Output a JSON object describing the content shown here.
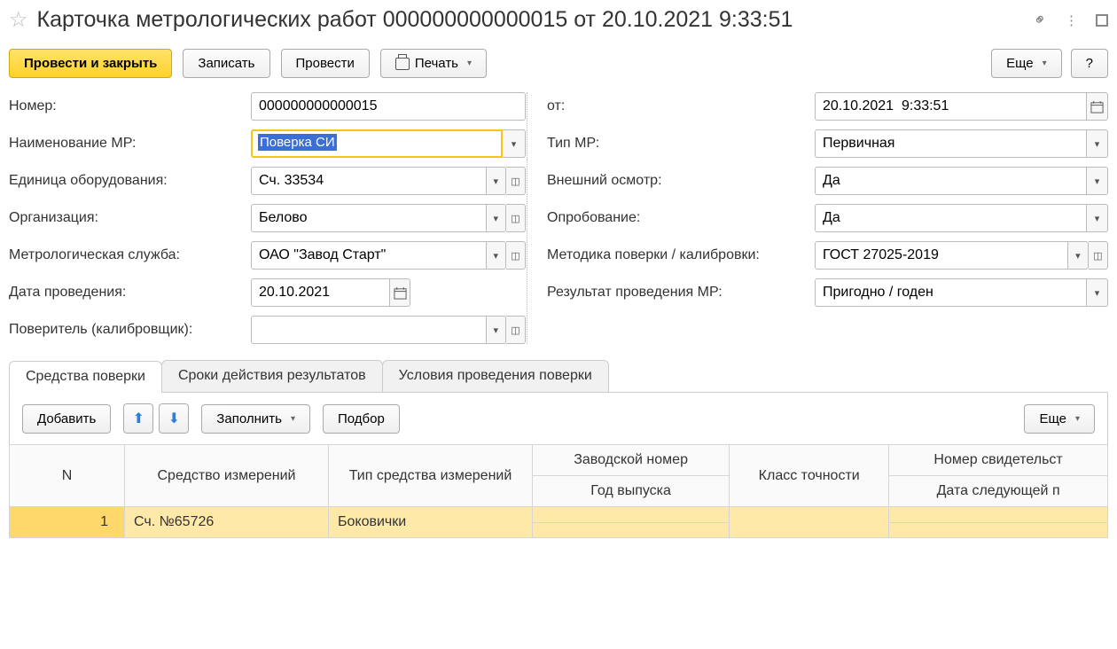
{
  "header": {
    "title": "Карточка метрологических работ 000000000000015 от 20.10.2021 9:33:51"
  },
  "toolbar": {
    "post_close": "Провести и закрыть",
    "save": "Записать",
    "post": "Провести",
    "print": "Печать",
    "more": "Еще",
    "help": "?"
  },
  "form": {
    "number_label": "Номер:",
    "number": "000000000000015",
    "date_label": "от:",
    "date": "20.10.2021  9:33:51",
    "name_mr_label": "Наименование МР:",
    "name_mr": "Поверка СИ",
    "type_mr_label": "Тип МР:",
    "type_mr": "Первичная",
    "equip_label": "Единица оборудования:",
    "equip": "Сч. 33534",
    "inspect_label": "Внешний осмотр:",
    "inspect": "Да",
    "org_label": "Организация:",
    "org": "Белово",
    "trial_label": "Опробование:",
    "trial": "Да",
    "service_label": "Метрологическая служба:",
    "service": "ОАО \"Завод Старт\"",
    "method_label": "Методика поверки / калибровки:",
    "method": "ГОСТ 27025-2019",
    "run_date_label": "Дата проведения:",
    "run_date": "20.10.2021",
    "result_label": "Результат проведения МР:",
    "result": "Пригодно / годен",
    "verifier_label": "Поверитель (калибровщик):",
    "verifier": ""
  },
  "tabs": {
    "t1": "Средства поверки",
    "t2": "Сроки действия результатов",
    "t3": "Условия проведения поверки"
  },
  "subtoolbar": {
    "add": "Добавить",
    "fill": "Заполнить",
    "pick": "Подбор",
    "more": "Еще"
  },
  "table": {
    "h_n": "N",
    "h_item": "Средство измерений",
    "h_type": "Тип средства измерений",
    "h_serial": "Заводской номер",
    "h_year": "Год выпуска",
    "h_class": "Класс точности",
    "h_cert": "Номер свидетельст",
    "h_next": "Дата следующей п",
    "rows": [
      {
        "n": "1",
        "item": "Сч. №65726",
        "type": "Боковички",
        "serial": "",
        "year": "",
        "class": "",
        "cert": "",
        "next": ""
      }
    ]
  }
}
